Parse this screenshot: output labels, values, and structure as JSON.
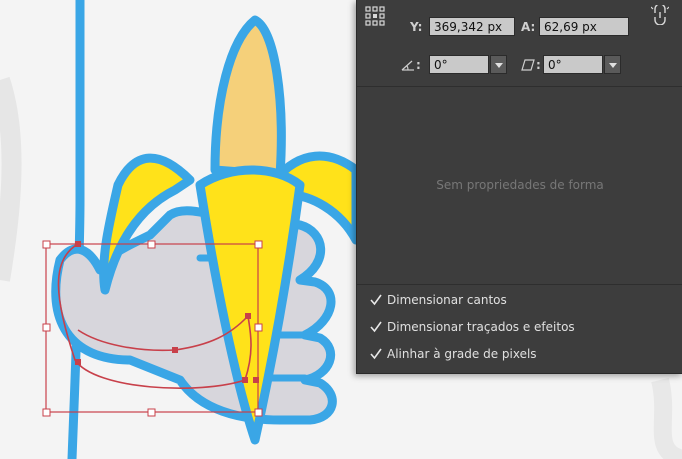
{
  "transform": {
    "y_label": "Y:",
    "y_value": "369,342 px",
    "a_label": "A:",
    "a_value": "62,69 px",
    "rotate_label": ":",
    "rotate_value": "0°",
    "shear_label": ":",
    "shear_value": "0°"
  },
  "shape_props": {
    "empty_message": "Sem propriedades de forma"
  },
  "options": [
    {
      "label": "Dimensionar cantos",
      "checked": true
    },
    {
      "label": "Dimensionar traçados e efeitos",
      "checked": true
    },
    {
      "label": "Alinhar à grade de pixels",
      "checked": true
    }
  ],
  "colors": {
    "outline": "#3aa6e6",
    "banana_yellow": "#ffe21a",
    "banana_pale": "#f5d07a",
    "hand_gray": "#d7d6dc",
    "selection": "#c8404a",
    "panel_bg": "#3d3d3d"
  },
  "icons": {
    "reference_point": "reference-point-icon",
    "constrain": "constrain-icon",
    "rotate": "rotate-angle-icon",
    "shear": "shear-icon",
    "dropdown": "chevron-down-icon",
    "checkbox": "checkmark-icon"
  }
}
